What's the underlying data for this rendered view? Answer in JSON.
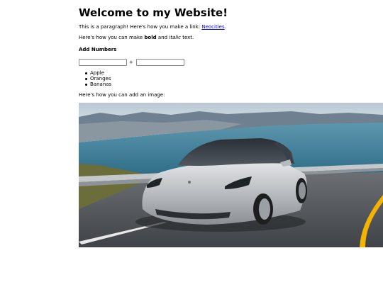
{
  "heading": "Welcome to my Website!",
  "paragraph1": {
    "text": "This is a paragraph! Here's how you make a link: ",
    "link_label": "Neocities",
    "after": "."
  },
  "paragraph2": {
    "before": "Here's how you can make ",
    "bold": "bold",
    "middle": " and ",
    "italic": "italic",
    "after": " text."
  },
  "add_numbers": {
    "title": "Add Numbers",
    "input1_value": "",
    "input2_value": "",
    "operator": "+"
  },
  "fruits": [
    "Apple",
    "Oranges",
    "Bananas"
  ],
  "image_caption": "Here's how you can add an image:",
  "image": {
    "description": "photo-car",
    "colors": {
      "sky": "#c9d6df",
      "sea": "#3f7d97",
      "hills": "#6f8190",
      "road": "#5a5e63",
      "car": "#c3c5c8",
      "stripe": "#f2b400"
    }
  }
}
